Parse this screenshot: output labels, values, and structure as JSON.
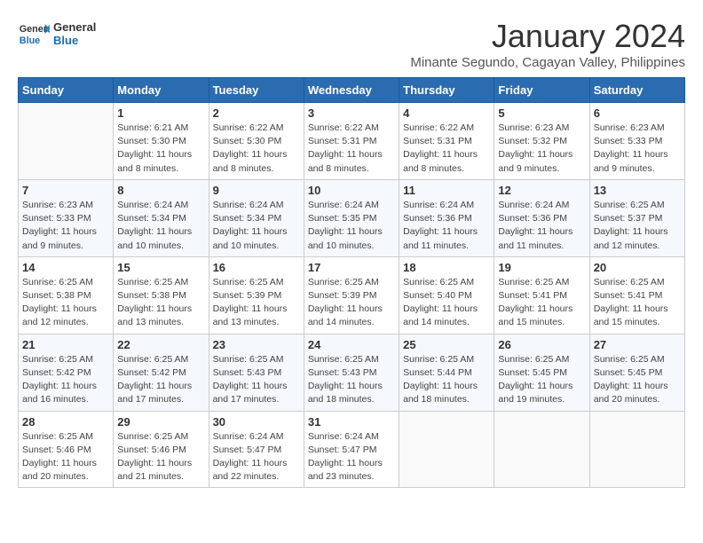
{
  "header": {
    "logo_general": "General",
    "logo_blue": "Blue",
    "month_title": "January 2024",
    "subtitle": "Minante Segundo, Cagayan Valley, Philippines"
  },
  "days_of_week": [
    "Sunday",
    "Monday",
    "Tuesday",
    "Wednesday",
    "Thursday",
    "Friday",
    "Saturday"
  ],
  "weeks": [
    [
      {
        "day": "",
        "info": ""
      },
      {
        "day": "1",
        "info": "Sunrise: 6:21 AM\nSunset: 5:30 PM\nDaylight: 11 hours\nand 8 minutes."
      },
      {
        "day": "2",
        "info": "Sunrise: 6:22 AM\nSunset: 5:30 PM\nDaylight: 11 hours\nand 8 minutes."
      },
      {
        "day": "3",
        "info": "Sunrise: 6:22 AM\nSunset: 5:31 PM\nDaylight: 11 hours\nand 8 minutes."
      },
      {
        "day": "4",
        "info": "Sunrise: 6:22 AM\nSunset: 5:31 PM\nDaylight: 11 hours\nand 8 minutes."
      },
      {
        "day": "5",
        "info": "Sunrise: 6:23 AM\nSunset: 5:32 PM\nDaylight: 11 hours\nand 9 minutes."
      },
      {
        "day": "6",
        "info": "Sunrise: 6:23 AM\nSunset: 5:33 PM\nDaylight: 11 hours\nand 9 minutes."
      }
    ],
    [
      {
        "day": "7",
        "info": "Sunrise: 6:23 AM\nSunset: 5:33 PM\nDaylight: 11 hours\nand 9 minutes."
      },
      {
        "day": "8",
        "info": "Sunrise: 6:24 AM\nSunset: 5:34 PM\nDaylight: 11 hours\nand 10 minutes."
      },
      {
        "day": "9",
        "info": "Sunrise: 6:24 AM\nSunset: 5:34 PM\nDaylight: 11 hours\nand 10 minutes."
      },
      {
        "day": "10",
        "info": "Sunrise: 6:24 AM\nSunset: 5:35 PM\nDaylight: 11 hours\nand 10 minutes."
      },
      {
        "day": "11",
        "info": "Sunrise: 6:24 AM\nSunset: 5:36 PM\nDaylight: 11 hours\nand 11 minutes."
      },
      {
        "day": "12",
        "info": "Sunrise: 6:24 AM\nSunset: 5:36 PM\nDaylight: 11 hours\nand 11 minutes."
      },
      {
        "day": "13",
        "info": "Sunrise: 6:25 AM\nSunset: 5:37 PM\nDaylight: 11 hours\nand 12 minutes."
      }
    ],
    [
      {
        "day": "14",
        "info": "Sunrise: 6:25 AM\nSunset: 5:38 PM\nDaylight: 11 hours\nand 12 minutes."
      },
      {
        "day": "15",
        "info": "Sunrise: 6:25 AM\nSunset: 5:38 PM\nDaylight: 11 hours\nand 13 minutes."
      },
      {
        "day": "16",
        "info": "Sunrise: 6:25 AM\nSunset: 5:39 PM\nDaylight: 11 hours\nand 13 minutes."
      },
      {
        "day": "17",
        "info": "Sunrise: 6:25 AM\nSunset: 5:39 PM\nDaylight: 11 hours\nand 14 minutes."
      },
      {
        "day": "18",
        "info": "Sunrise: 6:25 AM\nSunset: 5:40 PM\nDaylight: 11 hours\nand 14 minutes."
      },
      {
        "day": "19",
        "info": "Sunrise: 6:25 AM\nSunset: 5:41 PM\nDaylight: 11 hours\nand 15 minutes."
      },
      {
        "day": "20",
        "info": "Sunrise: 6:25 AM\nSunset: 5:41 PM\nDaylight: 11 hours\nand 15 minutes."
      }
    ],
    [
      {
        "day": "21",
        "info": "Sunrise: 6:25 AM\nSunset: 5:42 PM\nDaylight: 11 hours\nand 16 minutes."
      },
      {
        "day": "22",
        "info": "Sunrise: 6:25 AM\nSunset: 5:42 PM\nDaylight: 11 hours\nand 17 minutes."
      },
      {
        "day": "23",
        "info": "Sunrise: 6:25 AM\nSunset: 5:43 PM\nDaylight: 11 hours\nand 17 minutes."
      },
      {
        "day": "24",
        "info": "Sunrise: 6:25 AM\nSunset: 5:43 PM\nDaylight: 11 hours\nand 18 minutes."
      },
      {
        "day": "25",
        "info": "Sunrise: 6:25 AM\nSunset: 5:44 PM\nDaylight: 11 hours\nand 18 minutes."
      },
      {
        "day": "26",
        "info": "Sunrise: 6:25 AM\nSunset: 5:45 PM\nDaylight: 11 hours\nand 19 minutes."
      },
      {
        "day": "27",
        "info": "Sunrise: 6:25 AM\nSunset: 5:45 PM\nDaylight: 11 hours\nand 20 minutes."
      }
    ],
    [
      {
        "day": "28",
        "info": "Sunrise: 6:25 AM\nSunset: 5:46 PM\nDaylight: 11 hours\nand 20 minutes."
      },
      {
        "day": "29",
        "info": "Sunrise: 6:25 AM\nSunset: 5:46 PM\nDaylight: 11 hours\nand 21 minutes."
      },
      {
        "day": "30",
        "info": "Sunrise: 6:24 AM\nSunset: 5:47 PM\nDaylight: 11 hours\nand 22 minutes."
      },
      {
        "day": "31",
        "info": "Sunrise: 6:24 AM\nSunset: 5:47 PM\nDaylight: 11 hours\nand 23 minutes."
      },
      {
        "day": "",
        "info": ""
      },
      {
        "day": "",
        "info": ""
      },
      {
        "day": "",
        "info": ""
      }
    ]
  ]
}
